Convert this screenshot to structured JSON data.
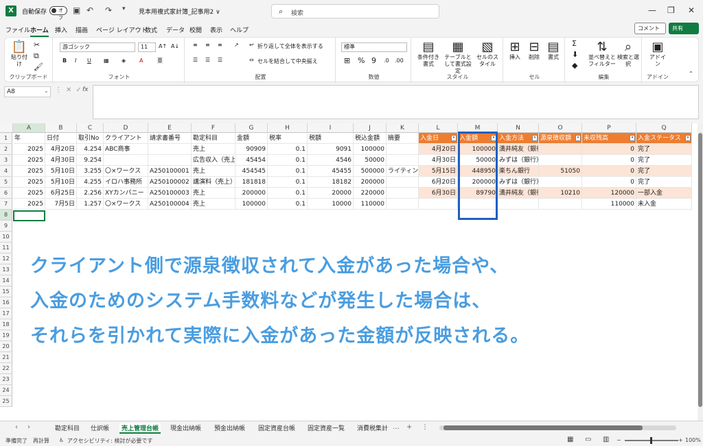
{
  "title": {
    "autosave": "自動保存",
    "toggle": "オフ",
    "filename": "見本用複式家計簿_記事用2 ∨",
    "search_placeholder": "検索"
  },
  "menu": {
    "tabs": [
      "ファイル",
      "ホーム",
      "挿入",
      "描画",
      "ページ レイアウト",
      "数式",
      "データ",
      "校閲",
      "表示",
      "ヘルプ"
    ],
    "comment": "コメント",
    "share": "共有"
  },
  "ribbon": {
    "clipboard": {
      "paste": "貼り付け",
      "label": "クリップボード"
    },
    "font": {
      "name": "游ゴシック",
      "size": "11",
      "label": "フォント"
    },
    "align": {
      "wrap": "折り返して全体を表示する",
      "merge": "セルを結合して中央揃え",
      "label": "配置"
    },
    "number": {
      "format": "標準",
      "label": "数値"
    },
    "style": {
      "cond": "条件付き書式",
      "table": "テーブルとして書式設定",
      "cell": "セルのスタイル",
      "label": "スタイル"
    },
    "cells": {
      "insert": "挿入",
      "delete": "削除",
      "format": "書式",
      "label": "セル"
    },
    "edit": {
      "sort": "並べ替えとフィルター",
      "find": "検索と選択",
      "label": "編集"
    },
    "addin": {
      "btn": "アドイン",
      "label": "アドイン"
    }
  },
  "formula": {
    "namebox": "A8",
    "fx": "fx"
  },
  "columns": [
    "A",
    "B",
    "C",
    "D",
    "E",
    "F",
    "G",
    "H",
    "I",
    "J",
    "K",
    "L",
    "M",
    "N",
    "O",
    "P",
    "Q"
  ],
  "rows": [
    "1",
    "2",
    "3",
    "4",
    "5",
    "6",
    "7",
    "8",
    "9",
    "10",
    "11",
    "12",
    "13",
    "14",
    "15",
    "16",
    "17",
    "18",
    "19",
    "20",
    "21",
    "22",
    "23",
    "24",
    "25"
  ],
  "left_headers": [
    "年",
    "日付",
    "取引No",
    "クライアント",
    "請求書番号",
    "勘定科目",
    "金額",
    "税率",
    "税額",
    "税込金額",
    "摘要"
  ],
  "left_rows": [
    [
      "2025",
      "4月20日",
      "4.254",
      "ABC商事",
      "",
      "売上",
      "90909",
      "0.1",
      "9091",
      "100000",
      ""
    ],
    [
      "2025",
      "4月30日",
      "9.254",
      "",
      "",
      "広告収入（売上）",
      "45454",
      "0.1",
      "4546",
      "50000",
      ""
    ],
    [
      "2025",
      "5月10日",
      "3.255",
      "〇×ワークス",
      "A250100001",
      "売上",
      "454545",
      "0.1",
      "45455",
      "500000",
      "ライティング"
    ],
    [
      "2025",
      "5月10日",
      "4.255",
      "イロハ事務所",
      "A250100002",
      "講演料（売上）",
      "181818",
      "0.1",
      "18182",
      "200000",
      ""
    ],
    [
      "2025",
      "6月25日",
      "2.256",
      "XYカンパニー",
      "A250100003",
      "売上",
      "200000",
      "0.1",
      "20000",
      "220000",
      ""
    ],
    [
      "2025",
      "7月5日",
      "1.257",
      "〇×ワークス",
      "A250100004",
      "売上",
      "100000",
      "0.1",
      "10000",
      "110000",
      ""
    ]
  ],
  "right_headers": [
    "入金日",
    "入金額",
    "入金方法",
    "源泉徴収額",
    "未収残高",
    "入金ステータス"
  ],
  "right_rows": [
    [
      "4月20日",
      "100000",
      "満井純友（銀行）",
      "",
      "0",
      "完了"
    ],
    [
      "4月30日",
      "50000",
      "みずは（銀行）",
      "",
      "0",
      "完了"
    ],
    [
      "5月15日",
      "448950",
      "楽ちん銀行",
      "51050",
      "0",
      "完了"
    ],
    [
      "6月20日",
      "200000",
      "みずは（銀行）",
      "",
      "0",
      "完了"
    ],
    [
      "6月30日",
      "89790",
      "満井純友（銀行）",
      "10210",
      "120000",
      "一部入金"
    ],
    [
      "",
      "",
      "",
      "",
      "110000",
      "未入金"
    ]
  ],
  "overlay": [
    "クライアント側で源泉徴収されて入金があった場合や、",
    "入金のためのシステム手数料などが発生した場合は、",
    "それらを引かれて実際に入金があった金額が反映される。"
  ],
  "sheets": [
    "勘定科目",
    "仕訳帳",
    "売上管理台帳",
    "現金出納帳",
    "預金出納帳",
    "固定資産台帳",
    "固定資産一覧",
    "消費税集計"
  ],
  "status": {
    "ready": "準備完了",
    "recalc": "再計算",
    "access": "アクセシビリティ: 検討が必要です",
    "zoom": "100%"
  },
  "colors": {
    "accent": "#107c41",
    "header_orange": "#ed7d31",
    "band": "#fce4d6",
    "overlay_text": "#4a9de0",
    "highlight": "#1f5fbf"
  }
}
